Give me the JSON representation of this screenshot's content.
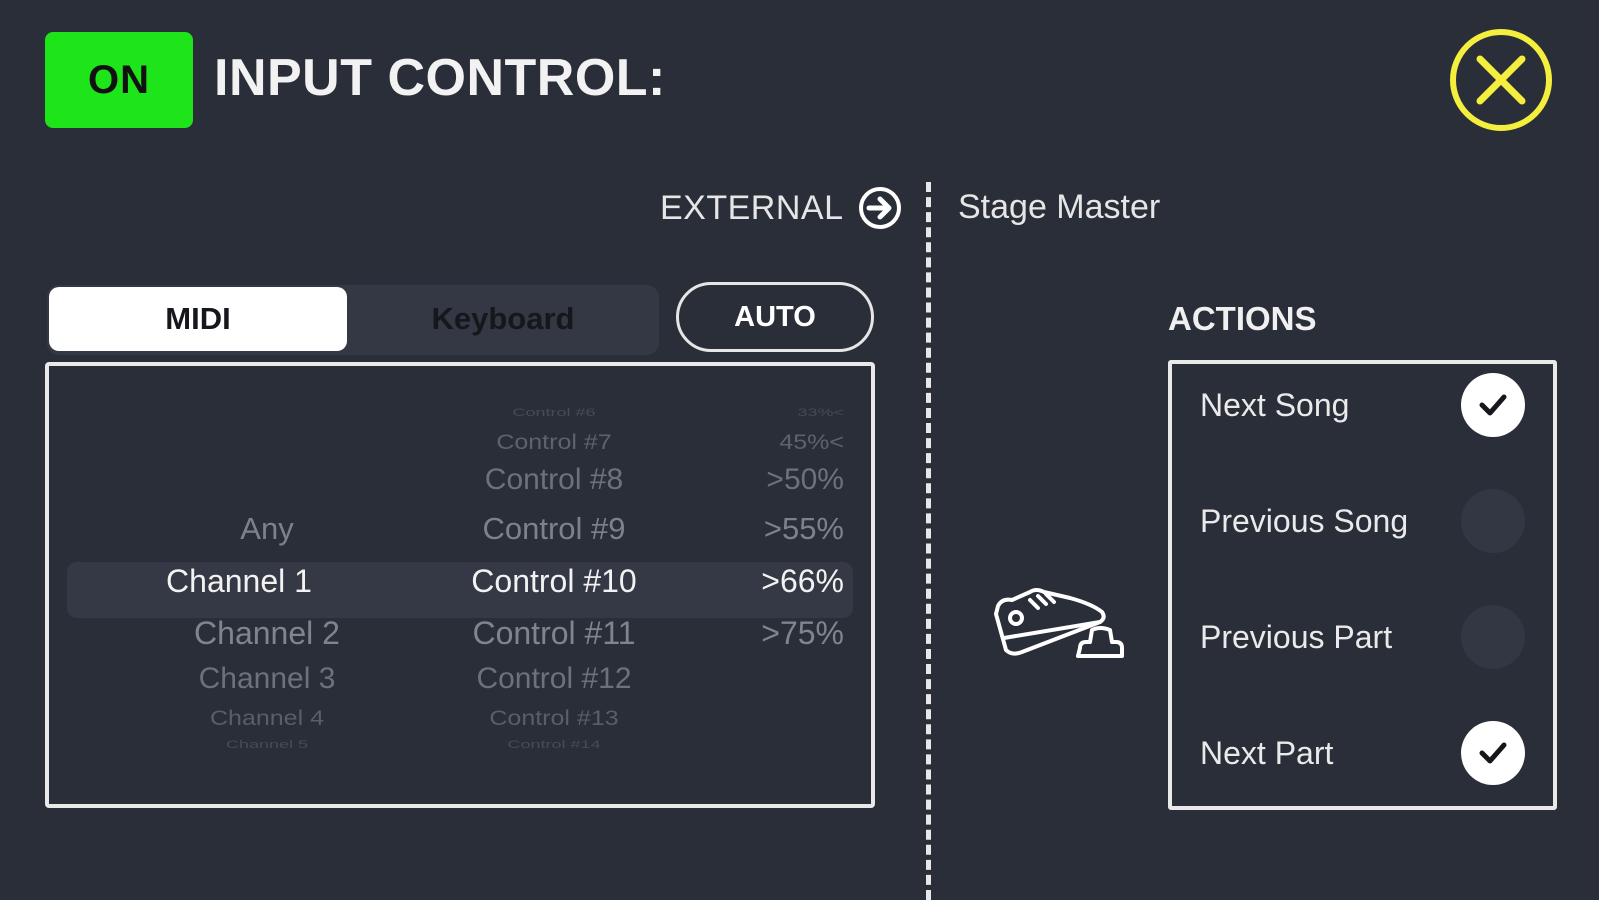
{
  "header": {
    "on_label": "ON",
    "title": "INPUT CONTROL:"
  },
  "colors": {
    "on_green": "#1ee51a",
    "close_yellow": "#f4ef3c",
    "background": "#2a2e39"
  },
  "routing": {
    "direction_label": "EXTERNAL",
    "device_name": "Stage Master"
  },
  "segmented": {
    "midi": "MIDI",
    "keyboard": "Keyboard",
    "selected": "MIDI"
  },
  "auto_label": "AUTO",
  "picker": {
    "channel": [
      "Any",
      "Channel 1",
      "Channel 2",
      "Channel 3",
      "Channel 4",
      "Channel 5"
    ],
    "control": [
      "Control #6",
      "Control #7",
      "Control #8",
      "Control #9",
      "Control #10",
      "Control #11",
      "Control #12",
      "Control #13",
      "Control #14"
    ],
    "threshold": [
      "33%<",
      "45%<",
      ">50%",
      ">55%",
      ">66%",
      ">75%"
    ],
    "selected": {
      "channel": "Channel 1",
      "control": "Control #10",
      "threshold": ">66%"
    }
  },
  "actions": {
    "label": "ACTIONS",
    "items": [
      {
        "label": "Next Song",
        "checked": true
      },
      {
        "label": "Previous Song",
        "checked": false
      },
      {
        "label": "Previous Part",
        "checked": false
      },
      {
        "label": "Next Part",
        "checked": true
      }
    ]
  },
  "icons": {
    "close": "close-circle-icon",
    "external": "arrow-right-circle-icon",
    "device": "footswitch-sneaker-icon",
    "check": "checkmark-icon"
  }
}
